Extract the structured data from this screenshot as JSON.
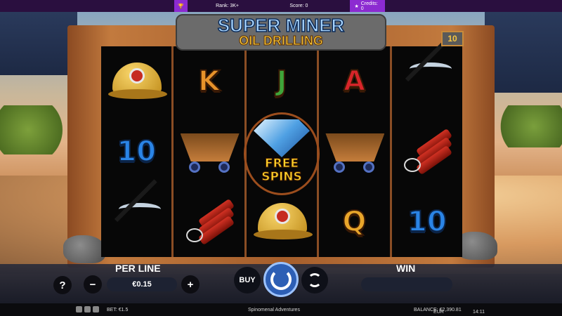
{
  "topbar": {
    "rank": "Rank: 3K+",
    "score": "Score: 0",
    "credits": "Credits: 0"
  },
  "logo": {
    "line1": "SUPER MINER",
    "line2": "OIL DRILLING"
  },
  "lines_count": "10",
  "reels": [
    [
      {
        "type": "helmet",
        "name": "helmet-symbol"
      },
      {
        "type": "ten",
        "label": "10"
      },
      {
        "type": "pick",
        "name": "pickaxe-symbol"
      }
    ],
    [
      {
        "type": "letter",
        "label": "K",
        "color": "#e7922a"
      },
      {
        "type": "cart",
        "name": "mine-cart-symbol"
      },
      {
        "type": "dyn",
        "name": "dynamite-symbol"
      }
    ],
    [
      {
        "type": "letter",
        "label": "J",
        "color": "#3fa53a"
      },
      {
        "type": "free",
        "l1": "FREE",
        "l2": "SPINS"
      },
      {
        "type": "helmet",
        "name": "helmet-symbol"
      }
    ],
    [
      {
        "type": "letter",
        "label": "A",
        "color": "#d8252a"
      },
      {
        "type": "cart",
        "name": "mine-cart-symbol"
      },
      {
        "type": "letter",
        "label": "Q",
        "color": "#e8a52a"
      }
    ],
    [
      {
        "type": "pick",
        "name": "pickaxe-symbol"
      },
      {
        "type": "dyn",
        "name": "dynamite-symbol"
      },
      {
        "type": "ten",
        "label": "10"
      }
    ]
  ],
  "controls": {
    "help": "?",
    "minus": "−",
    "plus": "+",
    "per_line_label": "PER LINE",
    "per_line_value": "€0.15",
    "buy": "BUY",
    "win_label": "WIN"
  },
  "status": {
    "bet": "BET: €1.5",
    "brand": "Spinomenal Adventures",
    "balance": "BALANCE: €2,390.81",
    "currency": "EUR",
    "time": "14:11"
  }
}
